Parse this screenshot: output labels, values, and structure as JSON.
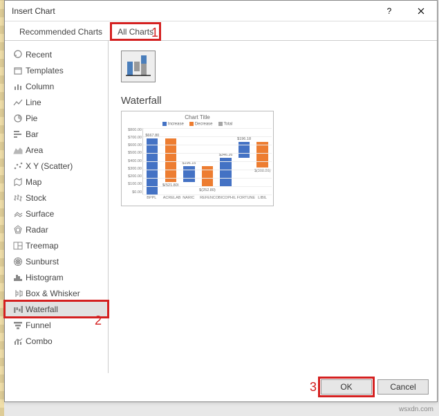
{
  "title": "Insert Chart",
  "tabs": {
    "recommended": "Recommended Charts",
    "all": "All Charts"
  },
  "annotations": {
    "one": "1",
    "two": "2",
    "three": "3"
  },
  "sidebar": {
    "items": [
      {
        "label": "Recent"
      },
      {
        "label": "Templates"
      },
      {
        "label": "Column"
      },
      {
        "label": "Line"
      },
      {
        "label": "Pie"
      },
      {
        "label": "Bar"
      },
      {
        "label": "Area"
      },
      {
        "label": "X Y (Scatter)"
      },
      {
        "label": "Map"
      },
      {
        "label": "Stock"
      },
      {
        "label": "Surface"
      },
      {
        "label": "Radar"
      },
      {
        "label": "Treemap"
      },
      {
        "label": "Sunburst"
      },
      {
        "label": "Histogram"
      },
      {
        "label": "Box & Whisker"
      },
      {
        "label": "Waterfall"
      },
      {
        "label": "Funnel"
      },
      {
        "label": "Combo"
      }
    ]
  },
  "main": {
    "type_name": "Waterfall"
  },
  "footer": {
    "ok": "OK",
    "cancel": "Cancel"
  },
  "watermark": "wsxdn.com",
  "chart_data": {
    "type": "waterfall",
    "title": "Chart Title",
    "legend": [
      "Increase",
      "Decrease",
      "Total"
    ],
    "ylabel": "",
    "xlabel": "",
    "ylim": [
      0,
      800
    ],
    "ytick_labels": [
      "$800.00",
      "$700.00",
      "$600.00",
      "$500.00",
      "$400.00",
      "$300.00",
      "$200.00",
      "$100.00",
      "$0.00"
    ],
    "categories": [
      "BPPL",
      "ACRELAB",
      "NARIC",
      "REFENCO",
      "BICOPHIL",
      "FORTUNE",
      "LIBIL"
    ],
    "bars": [
      {
        "type": "inc",
        "label": "$667.80",
        "bottom": 0,
        "top": 668
      },
      {
        "type": "dec",
        "label": "$(521.80)",
        "bottom": 146,
        "top": 668
      },
      {
        "type": "inc",
        "label": "$196.15",
        "bottom": 146,
        "top": 342
      },
      {
        "type": "dec",
        "label": "$(252.80)",
        "bottom": 89,
        "top": 342
      },
      {
        "type": "inc",
        "label": "$346.26",
        "bottom": 89,
        "top": 435
      },
      {
        "type": "inc",
        "label": "$196.18",
        "bottom": 435,
        "top": 631
      },
      {
        "type": "dec",
        "label": "$(308.26)",
        "bottom": 323,
        "top": 631
      }
    ]
  }
}
